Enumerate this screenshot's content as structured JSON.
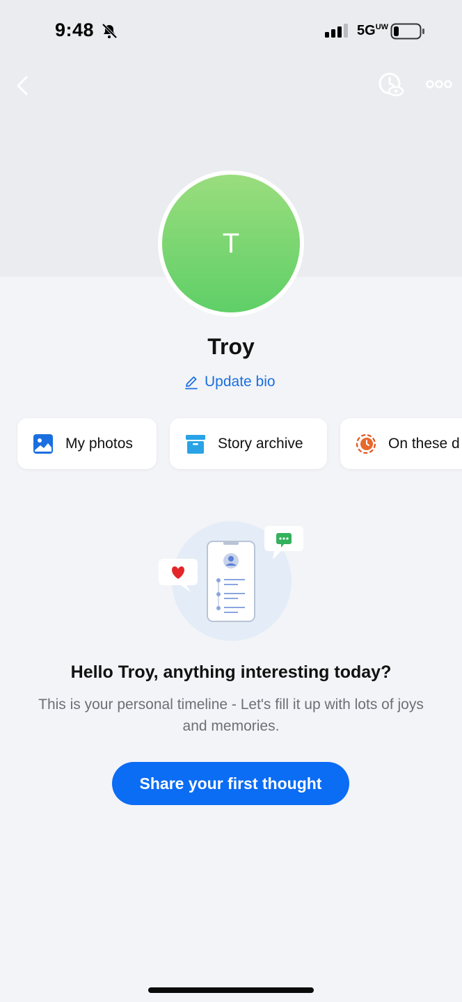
{
  "status_bar": {
    "time": "9:48",
    "network": "5G",
    "icons": [
      "bell-muted-icon",
      "signal-icon",
      "battery-icon"
    ]
  },
  "nav": {
    "back_icon": "chevron-left-icon",
    "viewers_icon": "clock-eye-icon",
    "more_icon": "more-dots-icon"
  },
  "profile": {
    "avatar_initial": "T",
    "avatar_color": "#6fd46c",
    "name": "Troy",
    "update_bio_label": "Update bio"
  },
  "quick_links": [
    {
      "label": "My photos",
      "icon": "photo-icon",
      "color": "#1a6fe0"
    },
    {
      "label": "Story archive",
      "icon": "archive-icon",
      "color": "#29a3e6"
    },
    {
      "label": "On these d",
      "icon": "memories-clock-icon",
      "color": "#e0541c"
    }
  ],
  "empty_state": {
    "title": "Hello Troy, anything interesting today?",
    "description": "This is your personal timeline - Let's fill it up with lots of joys and memories.",
    "cta_label": "Share your first thought"
  },
  "colors": {
    "accent": "#0b6cf4",
    "background": "#f3f4f7",
    "cover": "#eaecf0"
  }
}
